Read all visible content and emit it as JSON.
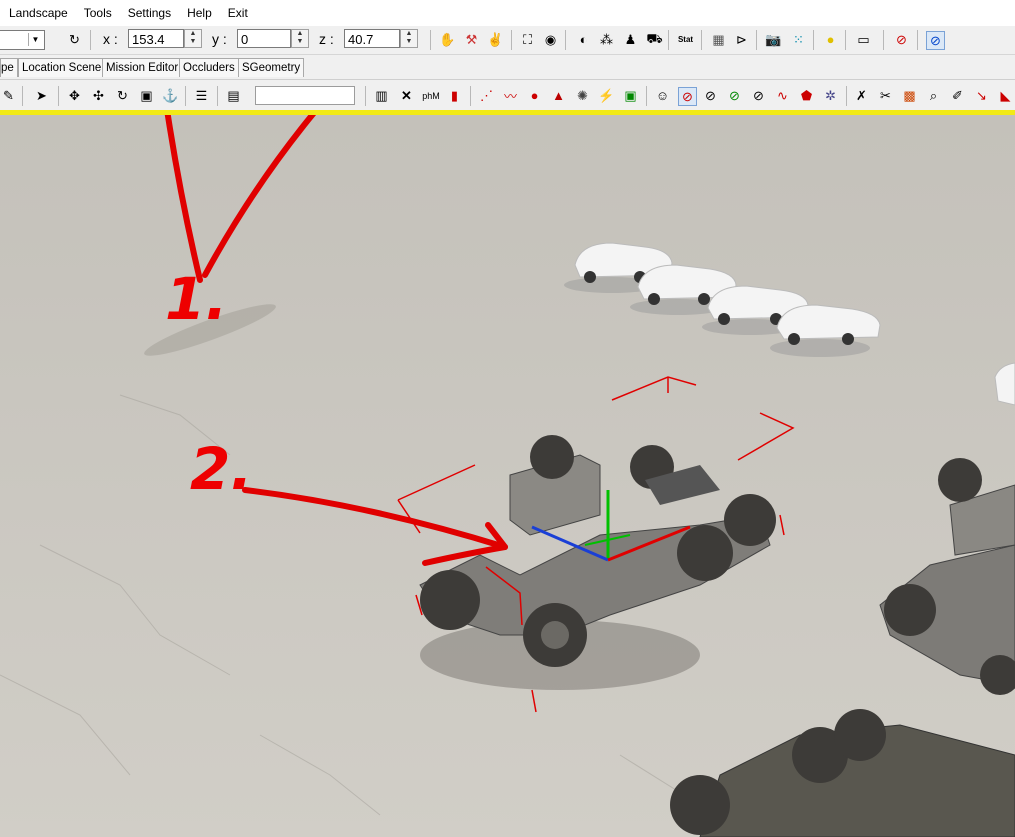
{
  "menu": {
    "items": [
      "Landscape",
      "Tools",
      "Settings",
      "Help",
      "Exit"
    ]
  },
  "coords": {
    "x_label": "x :",
    "x_value": "153.4",
    "y_label": "y :",
    "y_value": "0",
    "z_label": "z :",
    "z_value": "40.7"
  },
  "tabs": [
    "pe",
    "Location Scene",
    "Mission Editor",
    "Occluders",
    "SGeometry"
  ],
  "toolbar2": {
    "phm_label": "phM"
  },
  "annotations": {
    "one": "1.",
    "two": "2."
  },
  "colors": {
    "accent_yellow": "#f2ea16",
    "annotation_red": "#e00000",
    "ground": "#c9c6bf"
  }
}
